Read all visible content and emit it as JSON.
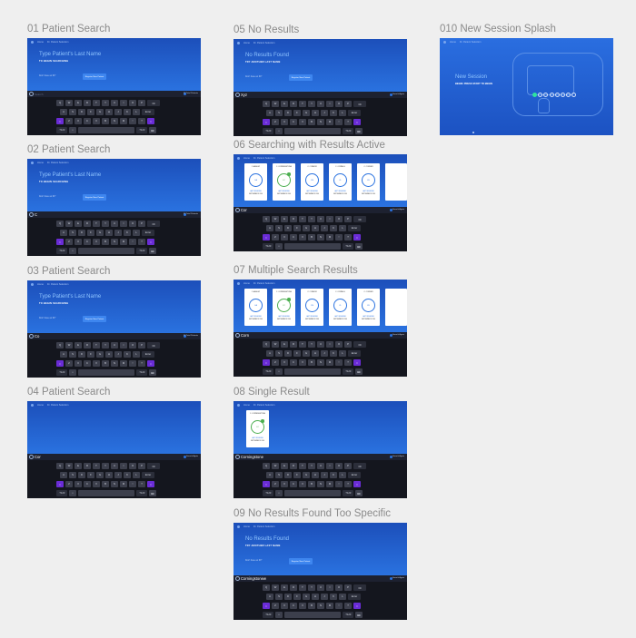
{
  "boards": [
    {
      "id": "b01",
      "title": "01 Patient Search",
      "type": "search",
      "hero_title": "Type Patient's Last Name",
      "hero_sub": "TO BEGIN SEARCHING",
      "hint": "Don't have an ID?",
      "button": "Register New Patient",
      "query": "Search",
      "placeholder": true,
      "right": "23 Total Patients"
    },
    {
      "id": "b02",
      "title": "02 Patient Search",
      "type": "search",
      "hero_title": "Type Patient's Last Name",
      "hero_sub": "TO BEGIN SEARCHING",
      "hint": "Don't have an ID?",
      "button": "Register New Patient",
      "query": "C",
      "placeholder": false,
      "right": "23 Total Patients"
    },
    {
      "id": "b03",
      "title": "03 Patient Search",
      "type": "search",
      "hero_title": "Type Patient's Last Name",
      "hero_sub": "TO BEGIN SEARCHING",
      "hint": "Don't have an ID?",
      "button": "Register New Patient",
      "query": "Co",
      "placeholder": false,
      "right": "23 Total Patients"
    },
    {
      "id": "b04",
      "title": "04 Patient Search",
      "type": "search_blank",
      "query": "Cor",
      "placeholder": false,
      "right": "Search Again"
    },
    {
      "id": "b05",
      "title": "05 No Results",
      "type": "search",
      "hero_title": "No Results Found",
      "hero_sub": "TRY ANOTHER LAST NAME",
      "hint": "Don't have an ID?",
      "button": "Register New Patient",
      "query": "Xyz",
      "placeholder": false,
      "right": "Search Again"
    },
    {
      "id": "b06",
      "title": "06 Searching with Results Active",
      "type": "results",
      "query": "Cor",
      "placeholder": false,
      "right": "Search Again"
    },
    {
      "id": "b07",
      "title": "07 Multiple Search Results",
      "type": "results",
      "query": "Corn",
      "placeholder": false,
      "right": "Search Again"
    },
    {
      "id": "b08",
      "title": "08 Single Result",
      "type": "single",
      "query": "Corningstone",
      "placeholder": false,
      "right": "Search Again"
    },
    {
      "id": "b09",
      "title": "09 No Results Found Too Specific",
      "type": "search",
      "hero_title": "No Results Found",
      "hero_sub": "TRY ANOTHER LAST NAME",
      "hint": "Don't have an ID?",
      "button": "Register New Patient",
      "query": "Corningstonew",
      "placeholder": false,
      "right": "Search Again"
    },
    {
      "id": "b10",
      "title": "010 New Session Splash",
      "type": "splash",
      "sp_title": "New Session",
      "sp_sub": "BEGIN: PRESS START TO BEGIN"
    }
  ],
  "nav": {
    "home": "Home",
    "tab": "Dr. Patient Selection"
  },
  "keyboard": {
    "row1": [
      "Q",
      "W",
      "E",
      "R",
      "T",
      "Y",
      "U",
      "I",
      "O",
      "P",
      "⌫"
    ],
    "row2": [
      "A",
      "S",
      "D",
      "F",
      "G",
      "H",
      "J",
      "K",
      "L",
      "Enter"
    ],
    "row3": [
      "⇧",
      "Z",
      "X",
      "C",
      "V",
      "B",
      "N",
      "M",
      "!",
      "?",
      "⇧"
    ],
    "row4": [
      ".?123",
      "☺",
      "space",
      ".?123",
      "⌨"
    ]
  },
  "patient_cards": [
    {
      "label": "C. ASHLEY",
      "initials": "CA",
      "foot": "LAST REVIEWED",
      "foot2": "SEPTEMBER 8 2016",
      "highlight": false
    },
    {
      "label": "C. CORNINGSTONE",
      "initials": "CC",
      "foot": "LAST REVIEWED",
      "foot2": "SEPTEMBER 8 2016",
      "highlight": true
    },
    {
      "label": "C. CONNOR",
      "initials": "CN",
      "foot": "LAST REVIEWED",
      "foot2": "SEPTEMBER 8 2016",
      "highlight": false
    },
    {
      "label": "C. CORNELL",
      "initials": "CL",
      "foot": "LAST REVIEWED",
      "foot2": "SEPTEMBER 8 2016",
      "highlight": false
    },
    {
      "label": "C. CORDER",
      "initials": "CD",
      "foot": "LAST REVIEWED",
      "foot2": "SEPTEMBER 8 2016",
      "highlight": false
    }
  ],
  "single_card": {
    "label": "C. CORNINGSTONE",
    "initials": "CC",
    "foot": "LAST REVIEWED",
    "foot2": "SEPTEMBER 8 2016"
  },
  "colors": {
    "brand": "#2a72e0",
    "accent_key": "#6a2cd6",
    "background": "#efefef"
  }
}
